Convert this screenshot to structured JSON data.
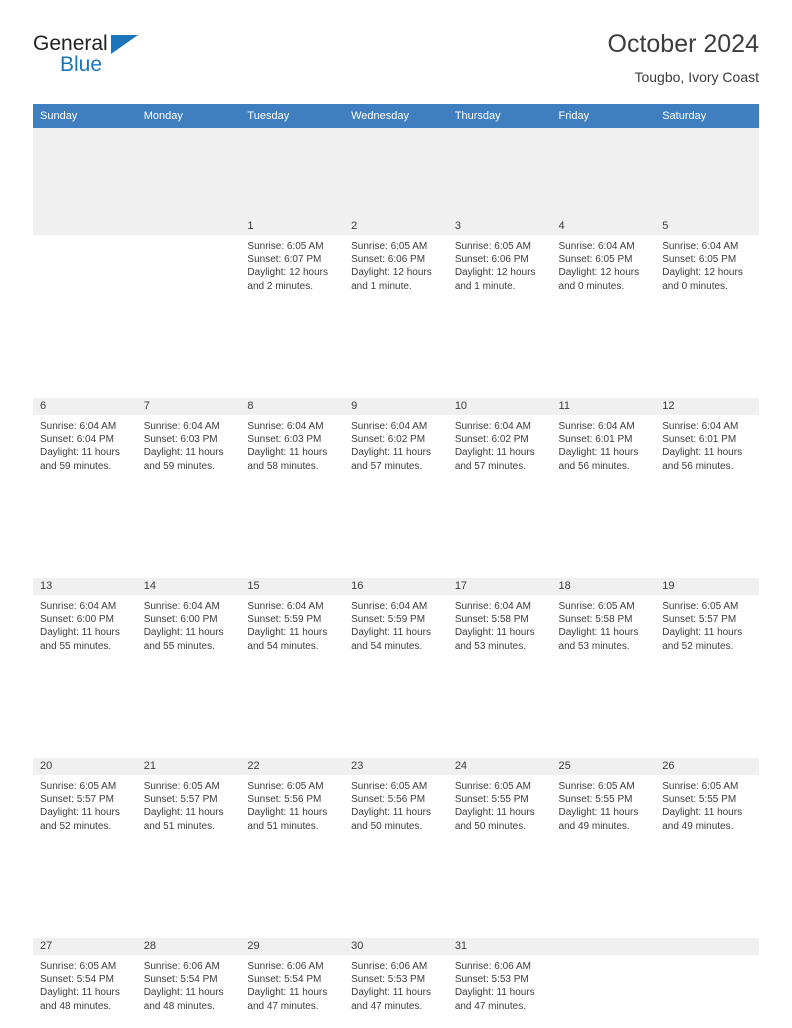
{
  "brand": {
    "name_primary": "General",
    "name_secondary": "Blue",
    "triangle_color": "#1b75bb"
  },
  "header": {
    "title": "October 2024",
    "subtitle": "Tougbo, Ivory Coast"
  },
  "theme": {
    "header_bg": "#3f7fbf",
    "separator": "#1f6cb0",
    "daynum_bg": "#f0f0f0",
    "text": "#3c3c3c"
  },
  "columns": [
    "Sunday",
    "Monday",
    "Tuesday",
    "Wednesday",
    "Thursday",
    "Friday",
    "Saturday"
  ],
  "labels": {
    "sunrise": "Sunrise:",
    "sunset": "Sunset:",
    "daylight": "Daylight:"
  },
  "weeks": [
    [
      {
        "day": ""
      },
      {
        "day": ""
      },
      {
        "day": "1",
        "sunrise": "Sunrise: 6:05 AM",
        "sunset": "Sunset: 6:07 PM",
        "daylight_1": "Daylight: 12 hours",
        "daylight_2": "and 2 minutes."
      },
      {
        "day": "2",
        "sunrise": "Sunrise: 6:05 AM",
        "sunset": "Sunset: 6:06 PM",
        "daylight_1": "Daylight: 12 hours",
        "daylight_2": "and 1 minute."
      },
      {
        "day": "3",
        "sunrise": "Sunrise: 6:05 AM",
        "sunset": "Sunset: 6:06 PM",
        "daylight_1": "Daylight: 12 hours",
        "daylight_2": "and 1 minute."
      },
      {
        "day": "4",
        "sunrise": "Sunrise: 6:04 AM",
        "sunset": "Sunset: 6:05 PM",
        "daylight_1": "Daylight: 12 hours",
        "daylight_2": "and 0 minutes."
      },
      {
        "day": "5",
        "sunrise": "Sunrise: 6:04 AM",
        "sunset": "Sunset: 6:05 PM",
        "daylight_1": "Daylight: 12 hours",
        "daylight_2": "and 0 minutes."
      }
    ],
    [
      {
        "day": "6",
        "sunrise": "Sunrise: 6:04 AM",
        "sunset": "Sunset: 6:04 PM",
        "daylight_1": "Daylight: 11 hours",
        "daylight_2": "and 59 minutes."
      },
      {
        "day": "7",
        "sunrise": "Sunrise: 6:04 AM",
        "sunset": "Sunset: 6:03 PM",
        "daylight_1": "Daylight: 11 hours",
        "daylight_2": "and 59 minutes."
      },
      {
        "day": "8",
        "sunrise": "Sunrise: 6:04 AM",
        "sunset": "Sunset: 6:03 PM",
        "daylight_1": "Daylight: 11 hours",
        "daylight_2": "and 58 minutes."
      },
      {
        "day": "9",
        "sunrise": "Sunrise: 6:04 AM",
        "sunset": "Sunset: 6:02 PM",
        "daylight_1": "Daylight: 11 hours",
        "daylight_2": "and 57 minutes."
      },
      {
        "day": "10",
        "sunrise": "Sunrise: 6:04 AM",
        "sunset": "Sunset: 6:02 PM",
        "daylight_1": "Daylight: 11 hours",
        "daylight_2": "and 57 minutes."
      },
      {
        "day": "11",
        "sunrise": "Sunrise: 6:04 AM",
        "sunset": "Sunset: 6:01 PM",
        "daylight_1": "Daylight: 11 hours",
        "daylight_2": "and 56 minutes."
      },
      {
        "day": "12",
        "sunrise": "Sunrise: 6:04 AM",
        "sunset": "Sunset: 6:01 PM",
        "daylight_1": "Daylight: 11 hours",
        "daylight_2": "and 56 minutes."
      }
    ],
    [
      {
        "day": "13",
        "sunrise": "Sunrise: 6:04 AM",
        "sunset": "Sunset: 6:00 PM",
        "daylight_1": "Daylight: 11 hours",
        "daylight_2": "and 55 minutes."
      },
      {
        "day": "14",
        "sunrise": "Sunrise: 6:04 AM",
        "sunset": "Sunset: 6:00 PM",
        "daylight_1": "Daylight: 11 hours",
        "daylight_2": "and 55 minutes."
      },
      {
        "day": "15",
        "sunrise": "Sunrise: 6:04 AM",
        "sunset": "Sunset: 5:59 PM",
        "daylight_1": "Daylight: 11 hours",
        "daylight_2": "and 54 minutes."
      },
      {
        "day": "16",
        "sunrise": "Sunrise: 6:04 AM",
        "sunset": "Sunset: 5:59 PM",
        "daylight_1": "Daylight: 11 hours",
        "daylight_2": "and 54 minutes."
      },
      {
        "day": "17",
        "sunrise": "Sunrise: 6:04 AM",
        "sunset": "Sunset: 5:58 PM",
        "daylight_1": "Daylight: 11 hours",
        "daylight_2": "and 53 minutes."
      },
      {
        "day": "18",
        "sunrise": "Sunrise: 6:05 AM",
        "sunset": "Sunset: 5:58 PM",
        "daylight_1": "Daylight: 11 hours",
        "daylight_2": "and 53 minutes."
      },
      {
        "day": "19",
        "sunrise": "Sunrise: 6:05 AM",
        "sunset": "Sunset: 5:57 PM",
        "daylight_1": "Daylight: 11 hours",
        "daylight_2": "and 52 minutes."
      }
    ],
    [
      {
        "day": "20",
        "sunrise": "Sunrise: 6:05 AM",
        "sunset": "Sunset: 5:57 PM",
        "daylight_1": "Daylight: 11 hours",
        "daylight_2": "and 52 minutes."
      },
      {
        "day": "21",
        "sunrise": "Sunrise: 6:05 AM",
        "sunset": "Sunset: 5:57 PM",
        "daylight_1": "Daylight: 11 hours",
        "daylight_2": "and 51 minutes."
      },
      {
        "day": "22",
        "sunrise": "Sunrise: 6:05 AM",
        "sunset": "Sunset: 5:56 PM",
        "daylight_1": "Daylight: 11 hours",
        "daylight_2": "and 51 minutes."
      },
      {
        "day": "23",
        "sunrise": "Sunrise: 6:05 AM",
        "sunset": "Sunset: 5:56 PM",
        "daylight_1": "Daylight: 11 hours",
        "daylight_2": "and 50 minutes."
      },
      {
        "day": "24",
        "sunrise": "Sunrise: 6:05 AM",
        "sunset": "Sunset: 5:55 PM",
        "daylight_1": "Daylight: 11 hours",
        "daylight_2": "and 50 minutes."
      },
      {
        "day": "25",
        "sunrise": "Sunrise: 6:05 AM",
        "sunset": "Sunset: 5:55 PM",
        "daylight_1": "Daylight: 11 hours",
        "daylight_2": "and 49 minutes."
      },
      {
        "day": "26",
        "sunrise": "Sunrise: 6:05 AM",
        "sunset": "Sunset: 5:55 PM",
        "daylight_1": "Daylight: 11 hours",
        "daylight_2": "and 49 minutes."
      }
    ],
    [
      {
        "day": "27",
        "sunrise": "Sunrise: 6:05 AM",
        "sunset": "Sunset: 5:54 PM",
        "daylight_1": "Daylight: 11 hours",
        "daylight_2": "and 48 minutes."
      },
      {
        "day": "28",
        "sunrise": "Sunrise: 6:06 AM",
        "sunset": "Sunset: 5:54 PM",
        "daylight_1": "Daylight: 11 hours",
        "daylight_2": "and 48 minutes."
      },
      {
        "day": "29",
        "sunrise": "Sunrise: 6:06 AM",
        "sunset": "Sunset: 5:54 PM",
        "daylight_1": "Daylight: 11 hours",
        "daylight_2": "and 47 minutes."
      },
      {
        "day": "30",
        "sunrise": "Sunrise: 6:06 AM",
        "sunset": "Sunset: 5:53 PM",
        "daylight_1": "Daylight: 11 hours",
        "daylight_2": "and 47 minutes."
      },
      {
        "day": "31",
        "sunrise": "Sunrise: 6:06 AM",
        "sunset": "Sunset: 5:53 PM",
        "daylight_1": "Daylight: 11 hours",
        "daylight_2": "and 47 minutes."
      },
      {
        "day": ""
      },
      {
        "day": ""
      }
    ]
  ]
}
